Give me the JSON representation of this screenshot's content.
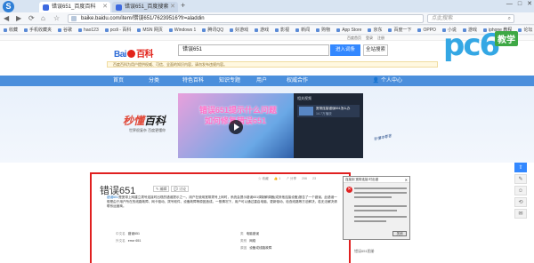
{
  "browser": {
    "tabs": [
      {
        "label": "错误651_百度百科",
        "active": true
      },
      {
        "label": "错误651_百度搜索",
        "active": false
      }
    ],
    "new_tab": "+",
    "window_controls": [
      "—",
      "□",
      "✕"
    ],
    "url": "baike.baidu.com/item/错误651/76239516?fr=aladdin",
    "search_placeholder": "点此搜索",
    "bookmarks": [
      "收藏",
      "手机收藏夹",
      "谷歌",
      "hao123",
      "pcdi - 百科",
      "MSN 网页",
      "Windows 1",
      "腾讯QQ",
      "好游戏",
      "游戏",
      "影视",
      "新闻",
      "购物",
      "App Store",
      "京东",
      "百度一下",
      "OPPO",
      "小说",
      "游戏",
      "iphone 教程",
      "论坛"
    ]
  },
  "baike": {
    "top_links": [
      "百度首页",
      "登录",
      "注册"
    ],
    "logo_text": "Bai",
    "logo_suffix": "百科",
    "search_value": "错误651",
    "enter_button": "进入词条",
    "web_search_button": "全站搜索",
    "notice": "百度百科为用户提供权威、可信、全面的知识内容，请勿发布违规内容。",
    "nav": [
      "首页",
      "分类",
      "特色百科",
      "知识专题",
      "用户",
      "权威合作"
    ],
    "person_center": "个人中心",
    "banner_logo_a": "秒懂",
    "banner_logo_b": "百科",
    "banner_sub": "世界很复杂 百度更懂你",
    "video_line1": "错误651提示什么问题",
    "video_line2": "如何修复错误651",
    "playlist_title": "相关视频",
    "playlist_item": "宽带连接错误651怎么办",
    "playlist_count": "14.7万播放",
    "hand_note": "秒懂本尊答",
    "entry_title": "错误651",
    "title_buttons": [
      "编辑",
      "讨论"
    ],
    "actions": [
      "收藏",
      "1",
      "分享",
      "206",
      "23"
    ],
    "description_kw": "错误651",
    "description": "是宽带上网建立拨号连接时出现的错误提示之一。用户在使用宽带拨号上网时，系统会提示错误651调制解调器(或其他连接设备)报告了一个错误。此错误一般是由于用户所在的线路故障、网卡驱动、拨号软件、设备故障等原因造成。一般情况下，用户可以通过重启电脑、更新驱动、检查线路等方法解决，若无法解决请联系运营商。",
    "info": [
      {
        "k": "中文名",
        "v": "错误651"
      },
      {
        "k": "类",
        "v": "电脑错误"
      },
      {
        "k": "外文名",
        "v": "error 651"
      },
      {
        "k": "类别",
        "v": "网络"
      },
      {
        "k": "",
        "v": ""
      },
      {
        "k": "原因",
        "v": "设备或线路故障"
      }
    ],
    "dialog_title": "连接到 宽带连接 时出错",
    "dialog_button": "关闭",
    "dialog_caption": "错误651图册"
  },
  "side_tools": [
    "⇧",
    "✎",
    "☺",
    "⟲",
    "✉"
  ],
  "watermark": {
    "brand": "pc6",
    "tag": "教学"
  },
  "colors": {
    "accent": "#3388ff",
    "nav": "#4b8fdc",
    "highlight_box": "#e02020",
    "brand_blue": "#34a7e4",
    "tag_green": "#3ea845"
  }
}
